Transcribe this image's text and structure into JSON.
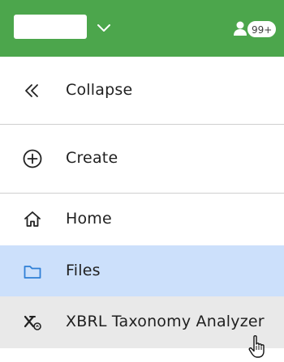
{
  "header": {
    "background_color": "#4ca64c",
    "menu_chevron_icon": "chevron-down-icon",
    "user_icon": "user-icon",
    "notification_count": "99+"
  },
  "nav": {
    "collapse": {
      "label": "Collapse",
      "icon": "double-chevron-left-icon"
    },
    "create": {
      "label": "Create",
      "icon": "plus-circle-icon"
    },
    "items": [
      {
        "label": "Home",
        "icon": "home-icon",
        "selected": false
      },
      {
        "label": "Files",
        "icon": "folder-icon",
        "selected": true
      },
      {
        "label": "XBRL Taxonomy Analyzer",
        "icon": "xbrl-analyzer-icon",
        "hovered": true
      }
    ]
  },
  "colors": {
    "selected_row": "#cce0fb",
    "hover_row": "#e9e9e9",
    "folder_icon": "#2f7fd6"
  }
}
